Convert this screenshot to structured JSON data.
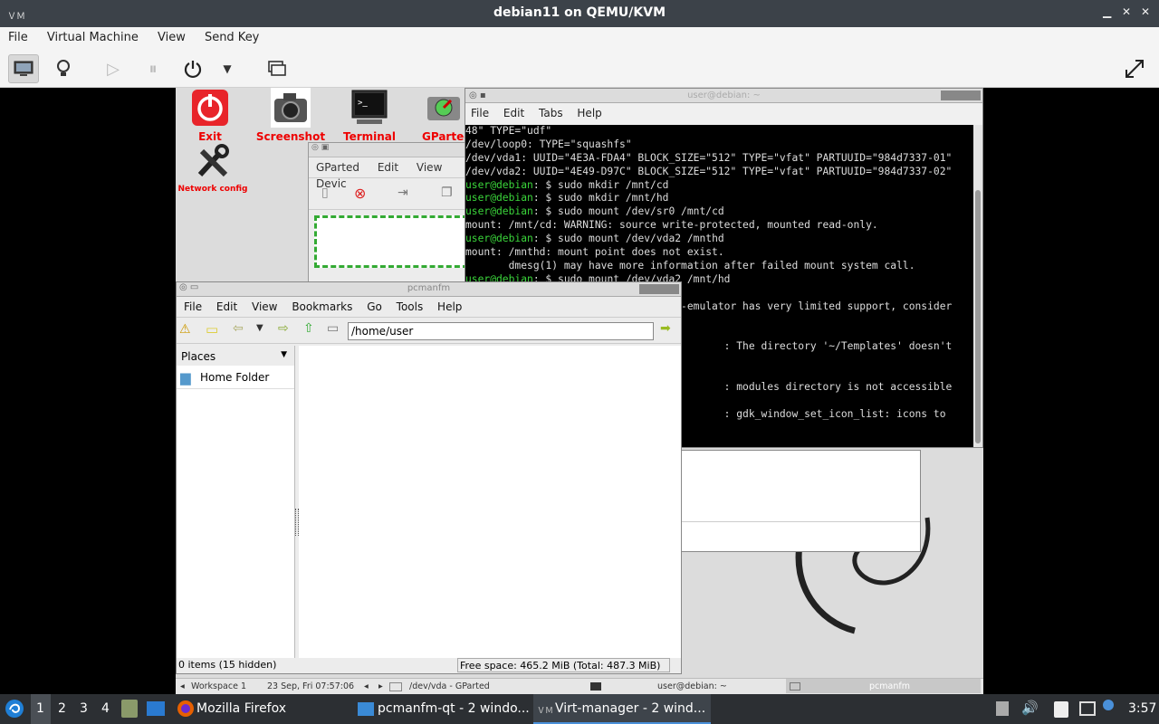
{
  "host": {
    "title": "debian11 on QEMU/KVM",
    "menu": [
      "File",
      "Virtual Machine",
      "View",
      "Send Key"
    ]
  },
  "desktop_icons": [
    {
      "label": "Exit"
    },
    {
      "label": "Screenshot"
    },
    {
      "label": "Terminal"
    },
    {
      "label": "GParted"
    },
    {
      "label": "Network config"
    }
  ],
  "terminal": {
    "title": "user@debian: ~",
    "menu": [
      "File",
      "Edit",
      "Tabs",
      "Help"
    ],
    "lines": [
      {
        "text": "48\" TYPE=\"udf\""
      },
      {
        "text": "/dev/loop0: TYPE=\"squashfs\""
      },
      {
        "text": "/dev/vda1: UUID=\"4E3A-FDA4\" BLOCK_SIZE=\"512\" TYPE=\"vfat\" PARTUUID=\"984d7337-01\""
      },
      {
        "text": "/dev/vda2: UUID=\"4E49-D97C\" BLOCK_SIZE=\"512\" TYPE=\"vfat\" PARTUUID=\"984d7337-02\""
      },
      {
        "prompt": "user@debian",
        "text": ": $ sudo mkdir /mnt/cd"
      },
      {
        "prompt": "user@debian",
        "text": ": $ sudo mkdir /mnt/hd"
      },
      {
        "prompt": "user@debian",
        "text": ": $ sudo mount /dev/sr0 /mnt/cd"
      },
      {
        "text": "mount: /mnt/cd: WARNING: source write-protected, mounted read-only."
      },
      {
        "prompt": "user@debian",
        "text": ": $ sudo mount /dev/vda2 /mnthd"
      },
      {
        "text": "mount: /mnthd: mount point does not exist."
      },
      {
        "text": "       dmesg(1) may have more information after failed mount system call."
      },
      {
        "prompt": "user@debian",
        "text": ": $ sudo mount /dev/vda2 /mnt/hd"
      },
      {
        "text": ""
      },
      {
        "text": "                                 al-emulator has very limited support, consider"
      },
      {
        "text": ""
      },
      {
        "text": ""
      },
      {
        "text": "                                          : The directory '~/Templates' doesn't"
      },
      {
        "text": ""
      },
      {
        "text": ""
      },
      {
        "text": "                                          : modules directory is not accessible"
      },
      {
        "text": ""
      },
      {
        "text": "                                          : gdk_window_set_icon_list: icons to"
      }
    ]
  },
  "gparted": {
    "menu": [
      "GParted",
      "Edit",
      "View",
      "Devic"
    ]
  },
  "pcmanfm": {
    "title": "pcmanfm",
    "menu": [
      "File",
      "Edit",
      "View",
      "Bookmarks",
      "Go",
      "Tools",
      "Help"
    ],
    "address": "/home/user",
    "places_header": "Places",
    "places": [
      "Home Folder"
    ],
    "status_left": "0 items (15 hidden)",
    "status_right": "Free space: 465.2 MiB (Total: 487.3 MiB)"
  },
  "guest_taskbar": {
    "workspace": "Workspace 1",
    "datetime": "23 Sep, Fri 07:57:06",
    "tasks": [
      "/dev/vda - GParted",
      "user@debian: ~",
      "pcmanfm"
    ]
  },
  "host_taskbar": {
    "workspaces": [
      "1",
      "2",
      "3",
      "4"
    ],
    "tasks": [
      "Mozilla Firefox",
      "pcmanfm-qt - 2 windo...",
      "Virt-manager - 2 wind..."
    ],
    "clock": "3:57"
  },
  "colors": {
    "prompt_green": "#3bd63b",
    "desk_label_red": "#e00000",
    "host_bar": "#3c4249"
  }
}
